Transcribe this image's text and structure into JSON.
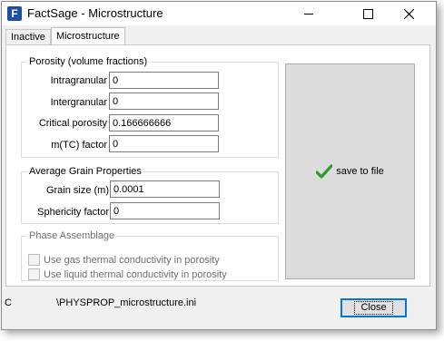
{
  "window": {
    "title": "FactSage - Microstructure"
  },
  "tabs": [
    {
      "label": "Inactive"
    },
    {
      "label": "Microstructure"
    }
  ],
  "porosity": {
    "legend": "Porosity (volume fractions)",
    "fields": [
      {
        "label": "Intragranular",
        "value": "0"
      },
      {
        "label": "Intergranular",
        "value": "0"
      },
      {
        "label": "Critical porosity",
        "value": "0.166666666"
      },
      {
        "label": "m(TC) factor",
        "value": "0"
      }
    ]
  },
  "grain": {
    "legend": "Average Grain Properties",
    "fields": [
      {
        "label": "Grain size (m)",
        "value": "0.0001"
      },
      {
        "label": "Sphericity factor",
        "value": "0"
      }
    ]
  },
  "phase": {
    "legend": "Phase Assemblage",
    "checkboxes": [
      {
        "label": "Use gas thermal conductivity in porosity",
        "checked": false,
        "enabled": false
      },
      {
        "label": "Use liquid thermal conductivity in porosity",
        "checked": false,
        "enabled": false
      }
    ]
  },
  "save_button": {
    "label": "save to file",
    "icon": "checkmark-icon",
    "icon_color": "#2e9b2e"
  },
  "footer": {
    "prefix": "C",
    "path": "\\PHYSPROP_microstructure.ini"
  },
  "close_button": {
    "label": "Close"
  },
  "colors": {
    "accent": "#0078d7",
    "app_icon": "#1d4fa8"
  }
}
